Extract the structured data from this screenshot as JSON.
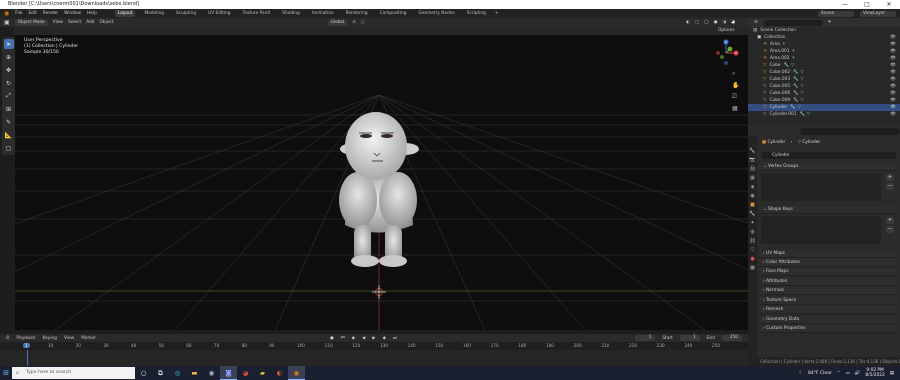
{
  "title": "Blender [C:\\Users\\cnerm001\\Downloads\\sebx.blend]",
  "window_buttons": [
    "—",
    "□",
    "✕"
  ],
  "menu": [
    "File",
    "Edit",
    "Render",
    "Window",
    "Help"
  ],
  "workspaces": [
    "Layout",
    "Modeling",
    "Sculpting",
    "UV Editing",
    "Texture Paint",
    "Shading",
    "Animation",
    "Rendering",
    "Compositing",
    "Geometry Nodes",
    "Scripting"
  ],
  "active_workspace": "Layout",
  "scene": {
    "label": "Scene",
    "view_layer": "ViewLayer"
  },
  "viewport_header": {
    "mode": "Object Mode",
    "menus": [
      "View",
      "Select",
      "Add",
      "Object"
    ],
    "orientation": "Global"
  },
  "viewport_info": {
    "line1": "User Perspective",
    "line2": "(1) Collection | Cylinder",
    "line3": "Sample 30/150"
  },
  "options_label": "Options",
  "gizmo": {
    "x": "X",
    "y": "Y",
    "z": "Z"
  },
  "outliner": {
    "root": "Scene Collection",
    "collection": "Collection",
    "items": [
      {
        "name": "Area",
        "type": "light"
      },
      {
        "name": "Area.001",
        "type": "light"
      },
      {
        "name": "Area.002",
        "type": "light"
      },
      {
        "name": "Cube",
        "type": "mesh"
      },
      {
        "name": "Cube.002",
        "type": "mesh"
      },
      {
        "name": "Cube.003",
        "type": "mesh"
      },
      {
        "name": "Cube.005",
        "type": "mesh"
      },
      {
        "name": "Cube.006",
        "type": "mesh"
      },
      {
        "name": "Cube.009",
        "type": "mesh"
      },
      {
        "name": "Cylinder",
        "type": "mesh"
      },
      {
        "name": "Cylinder.001",
        "type": "mesh"
      }
    ]
  },
  "properties": {
    "breadcrumb_object": "Cylinder",
    "breadcrumb_data": "Cylinder",
    "data_name": "Cylinder",
    "panels": [
      "Vertex Groups",
      "Shape Keys",
      "UV Maps",
      "Color Attributes",
      "Face Maps",
      "Attributes",
      "Normals",
      "Texture Space",
      "Remesh",
      "Geometry Data",
      "Custom Properties"
    ]
  },
  "timeline": {
    "menus": [
      "Playback",
      "Keying",
      "View",
      "Marker"
    ],
    "current_frame": "1",
    "start_label": "Start",
    "start": "1",
    "end_label": "End",
    "end": "250",
    "ticks": [
      "1",
      "10",
      "20",
      "30",
      "40",
      "50",
      "60",
      "70",
      "80",
      "90",
      "100",
      "110",
      "120",
      "130",
      "140",
      "150",
      "160",
      "170",
      "180",
      "190",
      "200",
      "210",
      "220",
      "230",
      "240",
      "250"
    ]
  },
  "statusbar": "Collection | Cylinder | Verts:2,088 | Faces:2,136 | Tris:4,136 | Objects:0/11 | 3.2.2",
  "taskbar": {
    "search_placeholder": "Type here to search",
    "weather": "84°F  Clear",
    "time": "9:02 PM",
    "date": "8/5/2022"
  }
}
